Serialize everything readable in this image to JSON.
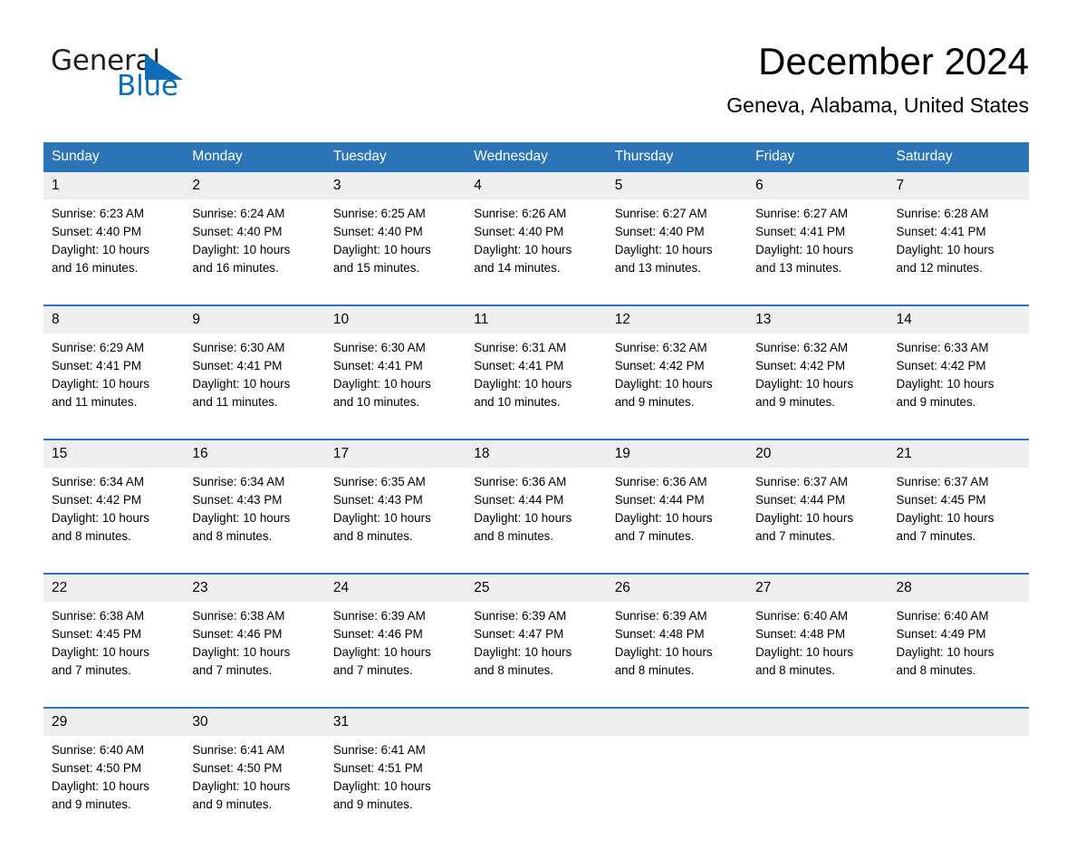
{
  "brand": {
    "name_part1": "General",
    "name_part2": "Blue",
    "accent_color": "#0f6cb6"
  },
  "header": {
    "month_title": "December 2024",
    "location": "Geneva, Alabama, United States"
  },
  "calendar": {
    "header_color": "#2b74b8",
    "daynum_band_color": "#efefef",
    "weekday_headers": [
      "Sunday",
      "Monday",
      "Tuesday",
      "Wednesday",
      "Thursday",
      "Friday",
      "Saturday"
    ],
    "weeks": [
      [
        {
          "day": "1",
          "sunrise": "Sunrise: 6:23 AM",
          "sunset": "Sunset: 4:40 PM",
          "daylight_l1": "Daylight: 10 hours",
          "daylight_l2": "and 16 minutes."
        },
        {
          "day": "2",
          "sunrise": "Sunrise: 6:24 AM",
          "sunset": "Sunset: 4:40 PM",
          "daylight_l1": "Daylight: 10 hours",
          "daylight_l2": "and 16 minutes."
        },
        {
          "day": "3",
          "sunrise": "Sunrise: 6:25 AM",
          "sunset": "Sunset: 4:40 PM",
          "daylight_l1": "Daylight: 10 hours",
          "daylight_l2": "and 15 minutes."
        },
        {
          "day": "4",
          "sunrise": "Sunrise: 6:26 AM",
          "sunset": "Sunset: 4:40 PM",
          "daylight_l1": "Daylight: 10 hours",
          "daylight_l2": "and 14 minutes."
        },
        {
          "day": "5",
          "sunrise": "Sunrise: 6:27 AM",
          "sunset": "Sunset: 4:40 PM",
          "daylight_l1": "Daylight: 10 hours",
          "daylight_l2": "and 13 minutes."
        },
        {
          "day": "6",
          "sunrise": "Sunrise: 6:27 AM",
          "sunset": "Sunset: 4:41 PM",
          "daylight_l1": "Daylight: 10 hours",
          "daylight_l2": "and 13 minutes."
        },
        {
          "day": "7",
          "sunrise": "Sunrise: 6:28 AM",
          "sunset": "Sunset: 4:41 PM",
          "daylight_l1": "Daylight: 10 hours",
          "daylight_l2": "and 12 minutes."
        }
      ],
      [
        {
          "day": "8",
          "sunrise": "Sunrise: 6:29 AM",
          "sunset": "Sunset: 4:41 PM",
          "daylight_l1": "Daylight: 10 hours",
          "daylight_l2": "and 11 minutes."
        },
        {
          "day": "9",
          "sunrise": "Sunrise: 6:30 AM",
          "sunset": "Sunset: 4:41 PM",
          "daylight_l1": "Daylight: 10 hours",
          "daylight_l2": "and 11 minutes."
        },
        {
          "day": "10",
          "sunrise": "Sunrise: 6:30 AM",
          "sunset": "Sunset: 4:41 PM",
          "daylight_l1": "Daylight: 10 hours",
          "daylight_l2": "and 10 minutes."
        },
        {
          "day": "11",
          "sunrise": "Sunrise: 6:31 AM",
          "sunset": "Sunset: 4:41 PM",
          "daylight_l1": "Daylight: 10 hours",
          "daylight_l2": "and 10 minutes."
        },
        {
          "day": "12",
          "sunrise": "Sunrise: 6:32 AM",
          "sunset": "Sunset: 4:42 PM",
          "daylight_l1": "Daylight: 10 hours",
          "daylight_l2": "and 9 minutes."
        },
        {
          "day": "13",
          "sunrise": "Sunrise: 6:32 AM",
          "sunset": "Sunset: 4:42 PM",
          "daylight_l1": "Daylight: 10 hours",
          "daylight_l2": "and 9 minutes."
        },
        {
          "day": "14",
          "sunrise": "Sunrise: 6:33 AM",
          "sunset": "Sunset: 4:42 PM",
          "daylight_l1": "Daylight: 10 hours",
          "daylight_l2": "and 9 minutes."
        }
      ],
      [
        {
          "day": "15",
          "sunrise": "Sunrise: 6:34 AM",
          "sunset": "Sunset: 4:42 PM",
          "daylight_l1": "Daylight: 10 hours",
          "daylight_l2": "and 8 minutes."
        },
        {
          "day": "16",
          "sunrise": "Sunrise: 6:34 AM",
          "sunset": "Sunset: 4:43 PM",
          "daylight_l1": "Daylight: 10 hours",
          "daylight_l2": "and 8 minutes."
        },
        {
          "day": "17",
          "sunrise": "Sunrise: 6:35 AM",
          "sunset": "Sunset: 4:43 PM",
          "daylight_l1": "Daylight: 10 hours",
          "daylight_l2": "and 8 minutes."
        },
        {
          "day": "18",
          "sunrise": "Sunrise: 6:36 AM",
          "sunset": "Sunset: 4:44 PM",
          "daylight_l1": "Daylight: 10 hours",
          "daylight_l2": "and 8 minutes."
        },
        {
          "day": "19",
          "sunrise": "Sunrise: 6:36 AM",
          "sunset": "Sunset: 4:44 PM",
          "daylight_l1": "Daylight: 10 hours",
          "daylight_l2": "and 7 minutes."
        },
        {
          "day": "20",
          "sunrise": "Sunrise: 6:37 AM",
          "sunset": "Sunset: 4:44 PM",
          "daylight_l1": "Daylight: 10 hours",
          "daylight_l2": "and 7 minutes."
        },
        {
          "day": "21",
          "sunrise": "Sunrise: 6:37 AM",
          "sunset": "Sunset: 4:45 PM",
          "daylight_l1": "Daylight: 10 hours",
          "daylight_l2": "and 7 minutes."
        }
      ],
      [
        {
          "day": "22",
          "sunrise": "Sunrise: 6:38 AM",
          "sunset": "Sunset: 4:45 PM",
          "daylight_l1": "Daylight: 10 hours",
          "daylight_l2": "and 7 minutes."
        },
        {
          "day": "23",
          "sunrise": "Sunrise: 6:38 AM",
          "sunset": "Sunset: 4:46 PM",
          "daylight_l1": "Daylight: 10 hours",
          "daylight_l2": "and 7 minutes."
        },
        {
          "day": "24",
          "sunrise": "Sunrise: 6:39 AM",
          "sunset": "Sunset: 4:46 PM",
          "daylight_l1": "Daylight: 10 hours",
          "daylight_l2": "and 7 minutes."
        },
        {
          "day": "25",
          "sunrise": "Sunrise: 6:39 AM",
          "sunset": "Sunset: 4:47 PM",
          "daylight_l1": "Daylight: 10 hours",
          "daylight_l2": "and 8 minutes."
        },
        {
          "day": "26",
          "sunrise": "Sunrise: 6:39 AM",
          "sunset": "Sunset: 4:48 PM",
          "daylight_l1": "Daylight: 10 hours",
          "daylight_l2": "and 8 minutes."
        },
        {
          "day": "27",
          "sunrise": "Sunrise: 6:40 AM",
          "sunset": "Sunset: 4:48 PM",
          "daylight_l1": "Daylight: 10 hours",
          "daylight_l2": "and 8 minutes."
        },
        {
          "day": "28",
          "sunrise": "Sunrise: 6:40 AM",
          "sunset": "Sunset: 4:49 PM",
          "daylight_l1": "Daylight: 10 hours",
          "daylight_l2": "and 8 minutes."
        }
      ],
      [
        {
          "day": "29",
          "sunrise": "Sunrise: 6:40 AM",
          "sunset": "Sunset: 4:50 PM",
          "daylight_l1": "Daylight: 10 hours",
          "daylight_l2": "and 9 minutes."
        },
        {
          "day": "30",
          "sunrise": "Sunrise: 6:41 AM",
          "sunset": "Sunset: 4:50 PM",
          "daylight_l1": "Daylight: 10 hours",
          "daylight_l2": "and 9 minutes."
        },
        {
          "day": "31",
          "sunrise": "Sunrise: 6:41 AM",
          "sunset": "Sunset: 4:51 PM",
          "daylight_l1": "Daylight: 10 hours",
          "daylight_l2": "and 9 minutes."
        },
        {
          "day": "",
          "sunrise": "",
          "sunset": "",
          "daylight_l1": "",
          "daylight_l2": ""
        },
        {
          "day": "",
          "sunrise": "",
          "sunset": "",
          "daylight_l1": "",
          "daylight_l2": ""
        },
        {
          "day": "",
          "sunrise": "",
          "sunset": "",
          "daylight_l1": "",
          "daylight_l2": ""
        },
        {
          "day": "",
          "sunrise": "",
          "sunset": "",
          "daylight_l1": "",
          "daylight_l2": ""
        }
      ]
    ]
  }
}
